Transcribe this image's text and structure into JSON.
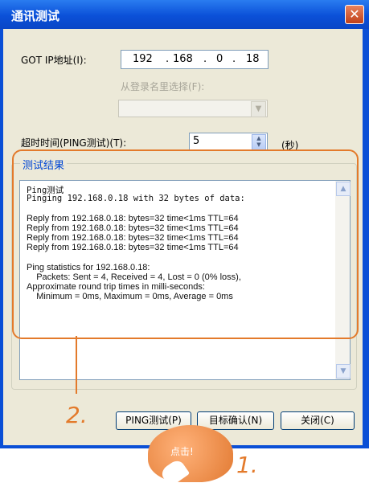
{
  "window": {
    "title": "通讯测试",
    "close_label": "✕"
  },
  "form": {
    "got_ip_label": "GOT IP地址(I):",
    "ip": {
      "o1": "192",
      "o2": "168",
      "o3": "0",
      "o4": "18"
    },
    "login_select_label": "从登录名里选择(F):",
    "timeout_label": "超时时间(PING测试)(T):",
    "timeout_value": "5",
    "timeout_unit": "(秒)"
  },
  "results": {
    "group_title": "测试结果",
    "lines": [
      "Ping测试",
      "Pinging 192.168.0.18 with 32 bytes of data:",
      "Reply from 192.168.0.18: bytes=32 time<1ms TTL=64",
      "Reply from 192.168.0.18: bytes=32 time<1ms TTL=64",
      "Reply from 192.168.0.18: bytes=32 time<1ms TTL=64",
      "Reply from 192.168.0.18: bytes=32 time<1ms TTL=64",
      "Ping statistics for 192.168.0.18:",
      "    Packets: Sent = 4, Received = 4, Lost = 0 (0% loss),",
      "Approximate round trip times in milli-seconds:",
      "    Minimum = 0ms, Maximum = 0ms, Average = 0ms"
    ]
  },
  "buttons": {
    "ping": "PING测试(P)",
    "confirm": "目标确认(N)",
    "close": "关闭(C)"
  },
  "annotations": {
    "step1": "1.",
    "step2": "2.",
    "click_hint": "点击!"
  },
  "colors": {
    "accent": "#e37a2b",
    "titlebar": "#0b50d8",
    "group_title": "#0046d5"
  }
}
